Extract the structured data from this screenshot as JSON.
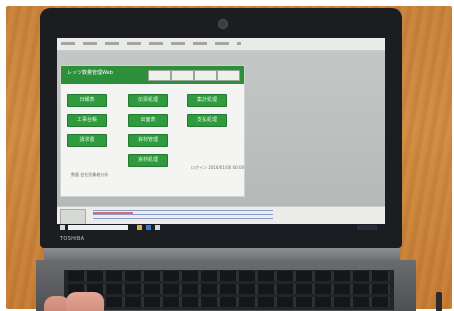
{
  "app": {
    "title": "レッツ数量管理Web",
    "tabs": [
      "",
      "",
      "",
      ""
    ],
    "buttons": [
      "日報表",
      "伝票処理",
      "集計処理",
      "工事台帳",
      "出面表",
      "支払処理",
      "請求書",
      "資材管理",
      "資材処理"
    ],
    "footer_text": "数量 会社別業者分析",
    "right_text": "ログイン 2016/01/00 00:00"
  },
  "bezel": {
    "brand": "TOSHIBA"
  },
  "colors": {
    "app_header": "#2e8f3a",
    "button_fill": "#2f9a3e",
    "taskbar": "#1b1d24",
    "wood": "#c9833c"
  },
  "icons": [
    "start-icon",
    "search-box",
    "taskbar-app-icon",
    "tray-icon"
  ]
}
